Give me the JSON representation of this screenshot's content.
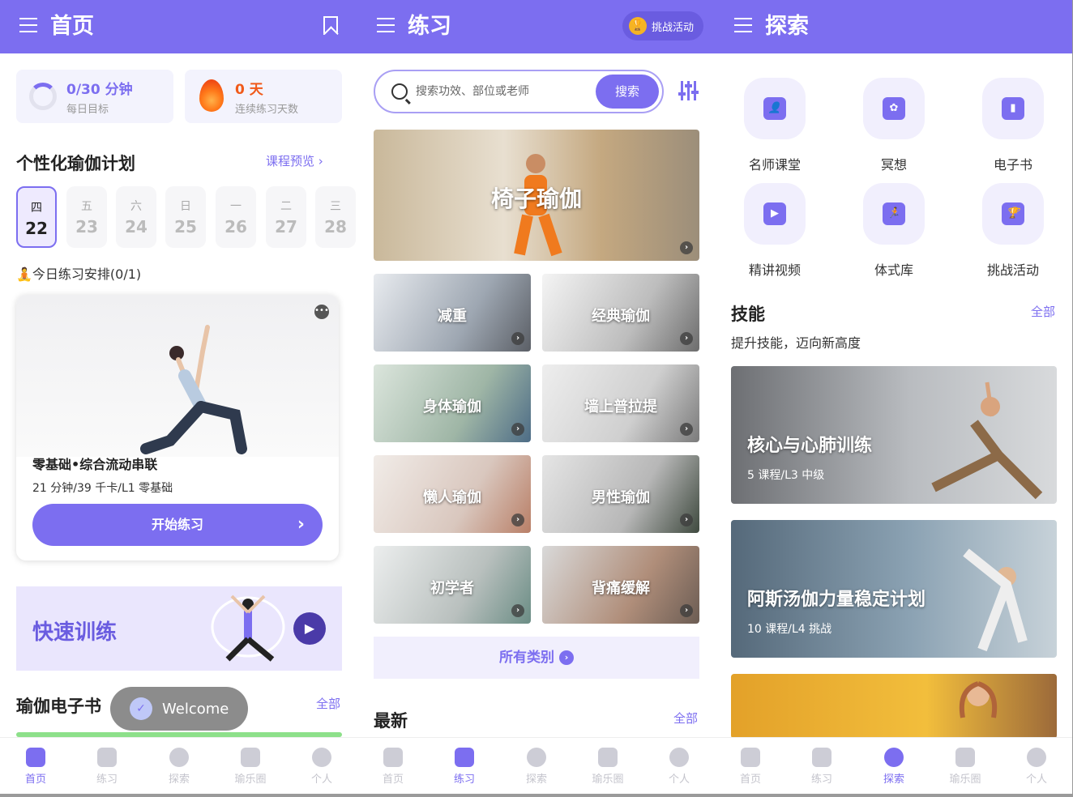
{
  "panel_home": {
    "title": "首页",
    "daily_goal_value": "0/30 分钟",
    "daily_goal_label": "每日目标",
    "streak_value": "0 天",
    "streak_label": "连续练习天数",
    "plan_title": "个性化瑜伽计划",
    "plan_link": "课程预览",
    "days": [
      {
        "weekday": "四",
        "date": "22"
      },
      {
        "weekday": "五",
        "date": "23"
      },
      {
        "weekday": "六",
        "date": "24"
      },
      {
        "weekday": "日",
        "date": "25"
      },
      {
        "weekday": "一",
        "date": "26"
      },
      {
        "weekday": "二",
        "date": "27"
      },
      {
        "weekday": "三",
        "date": "28"
      }
    ],
    "today_schedule": "今日练习安排(0/1)",
    "card_title": "零基础•综合流动串联",
    "card_meta": "21 分钟/39 千卡/L1 零基础",
    "start_button": "开始练习",
    "quick_training": "快速训练",
    "ebook_title": "瑜伽电子书",
    "ebook_link": "全部",
    "toast": "Welcome"
  },
  "panel_practice": {
    "title": "练习",
    "challenge_chip": "挑战活动",
    "search_placeholder": "搜索功效、部位或老师",
    "search_button": "搜索",
    "hero_tile": "椅子瑜伽",
    "tiles": [
      "减重",
      "经典瑜伽",
      "身体瑜伽",
      "墙上普拉提",
      "懒人瑜伽",
      "男性瑜伽",
      "初学者",
      "背痛缓解"
    ],
    "all_categories": "所有类别",
    "latest_title": "最新",
    "latest_link": "全部"
  },
  "panel_explore": {
    "title": "探索",
    "features": [
      "名师课堂",
      "冥想",
      "电子书",
      "精讲视频",
      "体式库",
      "挑战活动"
    ],
    "skills_title": "技能",
    "skills_link": "全部",
    "skills_subtitle": "提升技能，迈向新高度",
    "programs": [
      {
        "title": "核心与心肺训练",
        "meta": "5 课程/L3 中级"
      },
      {
        "title": "阿斯汤伽力量稳定计划",
        "meta": "10 课程/L4 挑战"
      }
    ]
  },
  "tabbar": [
    "首页",
    "练习",
    "探索",
    "瑜乐圈",
    "个人"
  ],
  "colors": {
    "accent": "#7c6ef0",
    "streak": "#f05a1a"
  }
}
